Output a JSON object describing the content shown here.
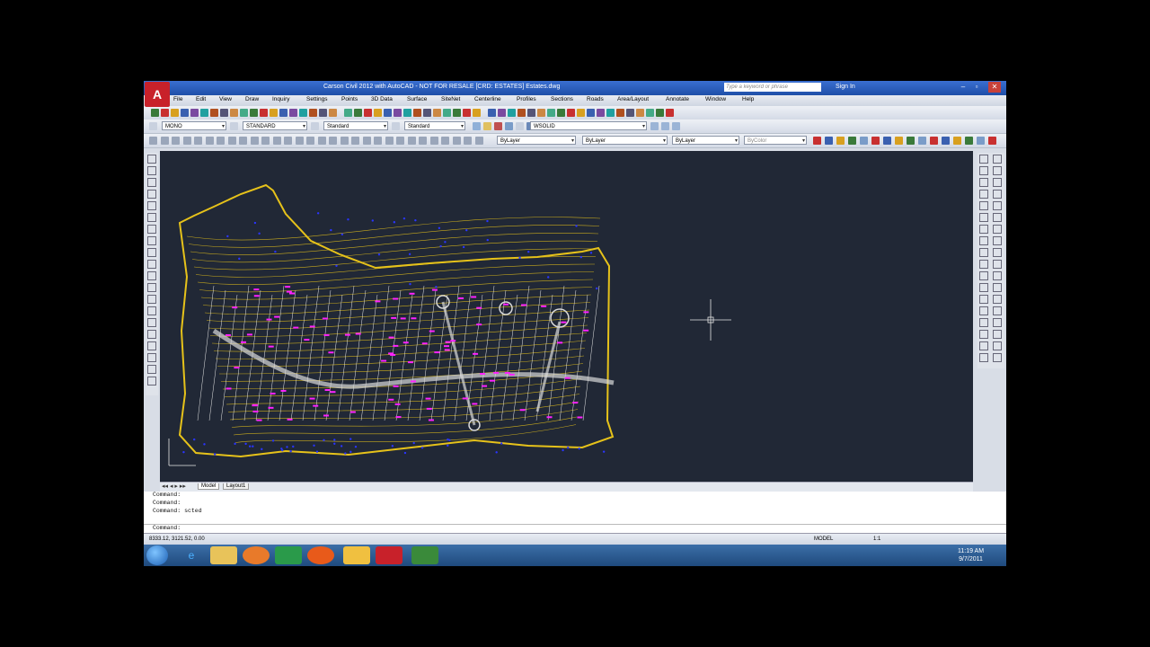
{
  "window": {
    "title": "Carson Civil 2012 with AutoCAD - NOT FOR RESALE [CRD: ESTATES] Estates.dwg",
    "search_placeholder": "Type a keyword or phrase",
    "sign_in": "Sign In",
    "min": "–",
    "max": "▫",
    "close": "✕"
  },
  "menus": [
    "File",
    "Edit",
    "View",
    "Draw",
    "Inquiry",
    "Settings",
    "Points",
    "3D Data",
    "Surface",
    "SiteNet",
    "Centerline",
    "Profiles",
    "Sections",
    "Roads",
    "Area/Layout",
    "Annotate",
    "Window",
    "Help"
  ],
  "toolbar2": {
    "textstyle": "MONO",
    "dimstyle": "STANDARD",
    "tablestyle": "Standard",
    "mleaderstyle": "Standard",
    "visual_style": "WSOLID"
  },
  "toolbar3": {
    "layer": "ByLayer",
    "linetype": "ByLayer",
    "lineweight": "ByLayer",
    "color": "ByColor"
  },
  "layout_tabs": {
    "model": "Model",
    "layout1": "Layout1"
  },
  "command_lines": [
    "Command:",
    "Command:",
    "Command: scted",
    "",
    "Command:"
  ],
  "status": {
    "coords": "8333.12, 3121.52, 0.00",
    "model": "MODEL",
    "scale": "1:1"
  },
  "taskbar": {
    "time": "11:19 AM",
    "date": "9/7/2011"
  },
  "colors": {
    "canvas": "#212836",
    "contours": "#e6c21a",
    "labels": "#ff22ff",
    "points": "#2a35ff"
  }
}
